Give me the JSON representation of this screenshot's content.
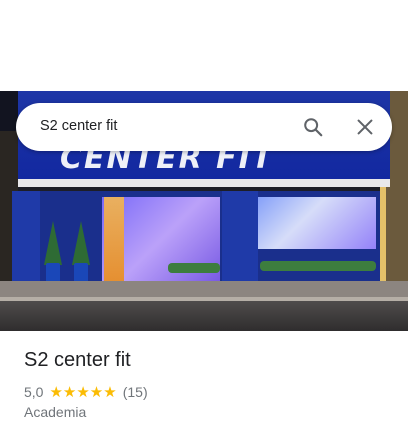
{
  "search": {
    "query": "S2 center fit"
  },
  "photo": {
    "sign_text": "CENTER FIT"
  },
  "place": {
    "name": "S2 center fit",
    "rating": "5,0",
    "stars": "★★★★★",
    "review_count": "(15)",
    "category": "Academia"
  },
  "icons": {
    "search": "search-icon",
    "close": "close-icon"
  },
  "colors": {
    "star": "#fbbc04",
    "facade": "#1e36a6"
  }
}
